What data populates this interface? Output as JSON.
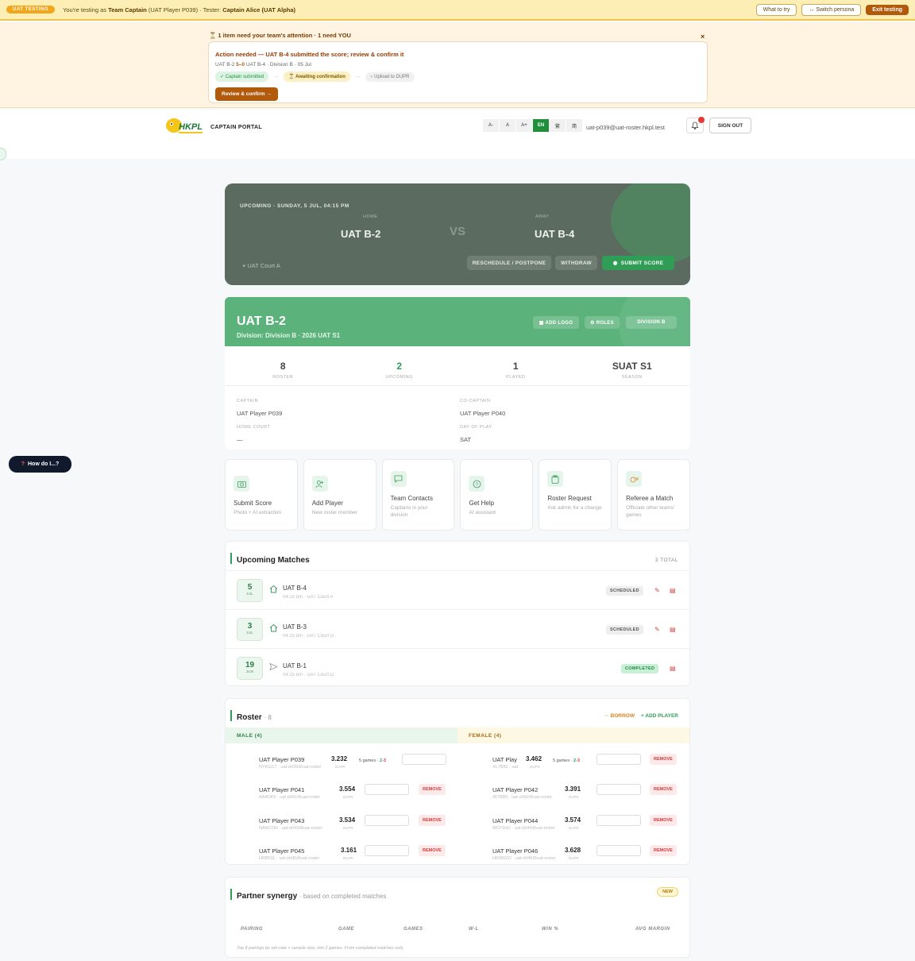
{
  "test_banner": {
    "pill": "UAT TESTING",
    "msg_prefix": "You're testing as",
    "persona": "Team Captain",
    "persona_detail": "(UAT Player P039)",
    "tester_prefix": "· Tester:",
    "tester": "Captain Alice (UAT Alpha)",
    "what_to_try": "What to try",
    "switch_persona": "↔ Switch persona",
    "exit_testing": "Exit testing"
  },
  "attention": {
    "heading": "⏳ 1 item need your team's attention · 1 need YOU",
    "close": "×",
    "title": "Action needed — UAT B-4 submitted the score; review & confirm it",
    "meta_home": "UAT B-2",
    "meta_score": "5–0",
    "meta_rest": "UAT B-4 · Division B · 05 Jul",
    "steps": [
      "✓ Captain submitted",
      "⏳ Awaiting confirmation",
      "○ Upload to DUPR"
    ],
    "arrow": "→",
    "review_button": "Review & confirm →"
  },
  "header": {
    "portal_label": "CAPTAIN PORTAL",
    "lang": [
      "A-",
      "A",
      "A+",
      "EN",
      "繁",
      "简"
    ],
    "email": "uat-p039@uat-roster.hkpl.test",
    "sign_out": "SIGN OUT",
    "logo_text": "HKPL"
  },
  "hero": {
    "when": "UPCOMING · SUNDAY, 5 JUL, 04:15 PM",
    "home_label": "HOME",
    "home_team": "UAT B-2",
    "vs": "VS",
    "away_label": "AWAY",
    "away_team": "UAT B-4",
    "court": "UAT Court A",
    "reschedule": "RESCHEDULE / POSTPONE",
    "withdraw": "WITHDRAW",
    "submit": "SUBMIT SCORE"
  },
  "team": {
    "name": "UAT B-2",
    "sub": "Division: Division B · 2026 UAT S1",
    "add_logo": "▦ ADD LOGO",
    "roles": "⚙ ROLES",
    "division": "DIVISION B",
    "stats": [
      {
        "value": "8",
        "label": "ROSTER"
      },
      {
        "value": "2",
        "label": "UPCOMING"
      },
      {
        "value": "1",
        "label": "PLAYED"
      },
      {
        "value": "SUAT S1",
        "label": "SEASON"
      }
    ],
    "captain_label": "CAPTAIN",
    "captain": "UAT Player P039",
    "cocaptain_label": "CO-CAPTAIN",
    "cocaptain": "UAT Player P040",
    "court_label": "HOME COURT",
    "court": "—",
    "day_label": "DAY OF PLAY",
    "day": "SAT"
  },
  "tiles": [
    {
      "title": "Submit Score",
      "sub": "Photo + AI extraction",
      "icon": "camera-icon"
    },
    {
      "title": "Add Player",
      "sub": "New roster member",
      "icon": "add-user-icon"
    },
    {
      "title": "Team Contacts",
      "sub": "Captains in your division",
      "icon": "chat-icon"
    },
    {
      "title": "Get Help",
      "sub": "AI assistant",
      "icon": "help-icon"
    },
    {
      "title": "Roster Request",
      "sub": "Ask admin for a change",
      "icon": "clipboard-icon"
    },
    {
      "title": "Referee a Match",
      "sub": "Officiate other teams' games",
      "icon": "whistle-icon"
    }
  ],
  "how_do_i": "How do I...?",
  "how_do_i_q": "?",
  "upcoming": {
    "title": "Upcoming Matches",
    "total": "3 TOTAL",
    "matches": [
      {
        "day": "5",
        "mon": "JUL",
        "opp": "UAT B-4",
        "sub": "04:15 pm · UAT Court A",
        "status": "SCHEDULED"
      },
      {
        "day": "3",
        "mon": "JUL",
        "opp": "UAT B-3",
        "sub": "04:15 pm · UAT Court D",
        "status": "SCHEDULED"
      },
      {
        "day": "19",
        "mon": "JUN",
        "opp": "UAT B-1",
        "sub": "04:15 pm · UAT Court D",
        "status": "COMPLETED"
      }
    ]
  },
  "roster": {
    "title": "Roster",
    "count": "· 8",
    "borrow": "⇔ BORROW",
    "add_player": "+ ADD PLAYER",
    "male_head": "MALE (4)",
    "female_head": "FEMALE (4)",
    "dupr_label": "DUPR",
    "remove": "REMOVE",
    "games_text": "5 games ·",
    "games_w": "2",
    "games_sep": "-",
    "games_l": "3",
    "male": [
      {
        "name": "UAT Player P039",
        "meta": "NYKGC7 · uat-p039@uat-roster",
        "dupr": "3.232"
      },
      {
        "name": "UAT Player P041",
        "meta": "AA4QK5 · uat-p041@uat-roster",
        "dupr": "3.554"
      },
      {
        "name": "UAT Player P043",
        "meta": "NANCQH · uat-p043@uat-roster",
        "dupr": "3.534"
      },
      {
        "name": "UAT Player P045",
        "meta": "HRB53L · uat-p045@uat-roster",
        "dupr": "3.161"
      }
    ],
    "female": [
      {
        "name": "UAT Play",
        "meta": "XL7B82 · uat",
        "dupr": "3.462"
      },
      {
        "name": "UAT Player P042",
        "meta": "45788D · uat-p042@uat-roster",
        "dupr": "3.391"
      },
      {
        "name": "UAT Player P044",
        "meta": "WQ7XHJ · uat-p044@uat-roster",
        "dupr": "3.574"
      },
      {
        "name": "UAT Player P046",
        "meta": "HR3WZQ · uat-p046@uat-roster",
        "dupr": "3.628"
      }
    ]
  },
  "synergy": {
    "title": "Partner synergy",
    "subtitle": "· based on completed matches",
    "badge": "NEW",
    "columns": [
      "PAIRING",
      "GAME",
      "GAMES",
      "W-L",
      "WIN %",
      "AVG MARGIN"
    ],
    "note": "Top 8 pairings by win-rate × sample size, min 2 games. From completed matches only."
  }
}
